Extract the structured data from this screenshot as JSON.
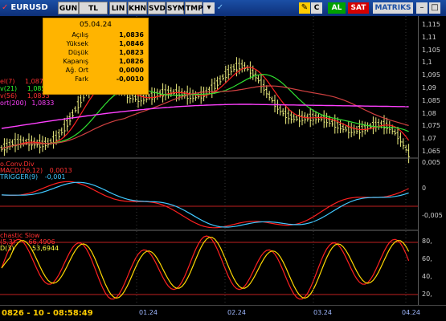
{
  "toolbar": {
    "symbol": "EURUSD",
    "symbol_icon": "red-chart-icon",
    "buttons": [
      "GUN",
      "TL",
      "LIN",
      "KHN",
      "SVD",
      "SYM",
      "TMP"
    ],
    "dropdown_icon": "chevron-down-icon",
    "check_icon": "check-icon",
    "pencil_icon": "pencil-icon",
    "c_label": "C",
    "al_label": "AL",
    "sat_label": "SAT",
    "brand": "MATRIKS",
    "window_icons": [
      "minimize-icon",
      "maximize-icon"
    ],
    "colors": {
      "bar": "#1b4fa5",
      "al": "#00a000",
      "sat": "#d40000"
    }
  },
  "infobox": {
    "date": "05.04.24",
    "rows": [
      {
        "k": "Açılış",
        "v": "1,0836"
      },
      {
        "k": "Yüksek",
        "v": "1,0846"
      },
      {
        "k": "Düşük",
        "v": "1,0823"
      },
      {
        "k": "Kapanış",
        "v": "1,0826"
      },
      {
        "k": "Ağ. Ort",
        "v": "0,0000"
      },
      {
        "k": "Fark",
        "v": "-0,0010"
      }
    ]
  },
  "price_panel": {
    "legends": [
      {
        "text": "el(7)",
        "val": "1,087",
        "color": "#ff3030"
      },
      {
        "text": "v(21)",
        "val": "1,0854",
        "color": "#30ff30"
      },
      {
        "text": "v(56)",
        "val": "1,0833",
        "color": "#ff3030"
      },
      {
        "text": "ort(200)",
        "val": "1,0833",
        "color": "#ff40ff"
      }
    ],
    "yticks": [
      "1,115",
      "1,11",
      "1,105",
      "1,1",
      "1,095",
      "1,09",
      "1,085",
      "1,08",
      "1,075",
      "1,07",
      "1,065"
    ]
  },
  "macd_panel": {
    "title": "o.Conv.Div",
    "legends": [
      {
        "text": "MACD(26,12)",
        "val": "0,0013",
        "color": "#ff3030"
      },
      {
        "text": "TRIGGER(9)",
        "val": "-0,001",
        "color": "#40c8ff"
      }
    ],
    "yticks": [
      "0,005",
      "0",
      "-0,005"
    ]
  },
  "stoch_panel": {
    "title": "chastic Slow",
    "legends": [
      {
        "text": "(5,3)",
        "val": "66,4906",
        "color": "#ff3030"
      },
      {
        "text": "D(3)",
        "val": "53,6944",
        "color": "#ffff40"
      }
    ],
    "yticks": [
      "80,",
      "60,",
      "40,",
      "20,"
    ]
  },
  "statusbar": {
    "clock": "0826 - 10 - 08:58:49",
    "xlabels": [
      "01.24",
      "02.24",
      "03.24",
      "04.24"
    ]
  }
}
